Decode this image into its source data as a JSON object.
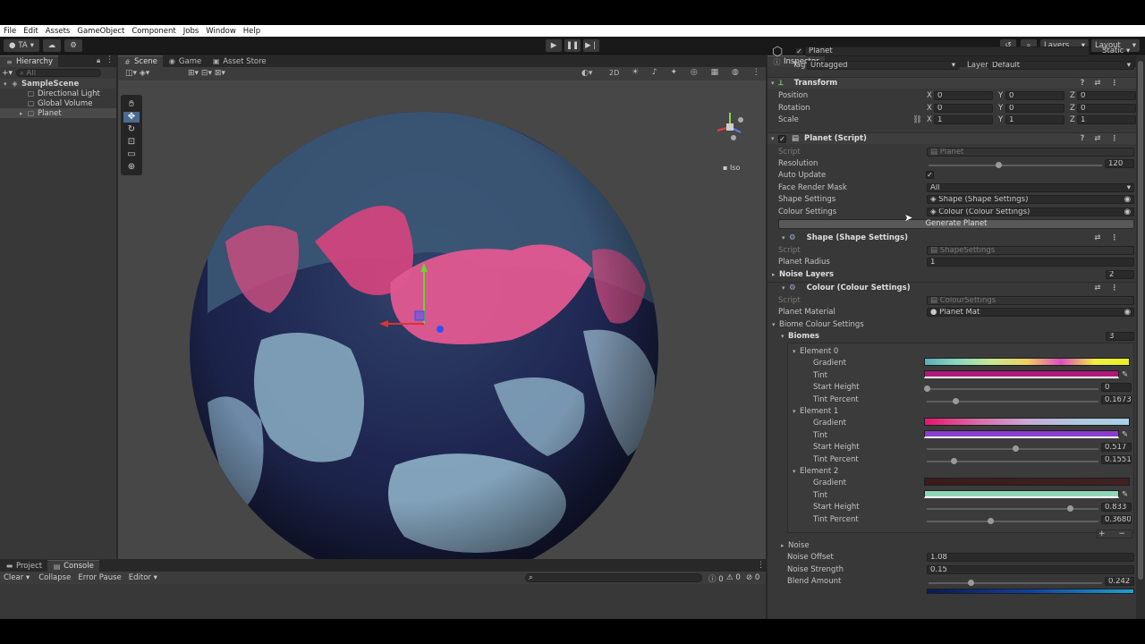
{
  "menu": [
    "File",
    "Edit",
    "Assets",
    "GameObject",
    "Component",
    "Jobs",
    "Window",
    "Help"
  ],
  "toolbar": {
    "account": "TA",
    "layers": "Layers",
    "layout": "Layout"
  },
  "hierarchy": {
    "tab": "Hierarchy",
    "search_placeholder": "All",
    "scene": "SampleScene",
    "items": [
      "Directional Light",
      "Global Volume",
      "Planet"
    ]
  },
  "scene_view": {
    "tabs": [
      "Scene",
      "Game",
      "Asset Store"
    ],
    "mode_2d": "2D",
    "iso": "Iso"
  },
  "inspector": {
    "tab": "Inspector",
    "object_name": "Planet",
    "static": "Static",
    "tag_label": "Tag",
    "tag_value": "Untagged",
    "layer_label": "Layer",
    "layer_value": "Default",
    "transform": {
      "title": "Transform",
      "rows": [
        {
          "label": "Position",
          "x": "0",
          "y": "0",
          "z": "0"
        },
        {
          "label": "Rotation",
          "x": "0",
          "y": "0",
          "z": "0"
        },
        {
          "label": "Scale",
          "x": "1",
          "y": "1",
          "z": "1"
        }
      ]
    },
    "planet_script": {
      "title": "Planet (Script)",
      "script_label": "Script",
      "script_value": "Planet",
      "resolution_label": "Resolution",
      "resolution_value": "120",
      "resolution_fraction": 0.4,
      "auto_update_label": "Auto Update",
      "face_mask_label": "Face Render Mask",
      "face_mask_value": "All",
      "shape_label": "Shape Settings",
      "shape_value": "Shape (Shape Settings)",
      "colour_label": "Colour Settings",
      "colour_value": "Colour (Colour Settings)",
      "generate_button": "Generate Planet"
    },
    "shape": {
      "title": "Shape (Shape Settings)",
      "script_label": "Script",
      "script_value": "ShapeSettings",
      "radius_label": "Planet Radius",
      "radius_value": "1",
      "noise_layers_label": "Noise Layers",
      "noise_layers_value": "2"
    },
    "colour": {
      "title": "Colour (Colour Settings)",
      "script_label": "Script",
      "script_value": "ColourSettings",
      "material_label": "Planet Material",
      "material_value": "Planet Mat",
      "biome_label": "Biome Colour Settings",
      "biomes_label": "Biomes",
      "biomes_value": "3",
      "elements": [
        {
          "name": "Element 0",
          "gradient_label": "Gradient",
          "tint_label": "Tint",
          "start_label": "Start Height",
          "start_value": "0",
          "start_fraction": 0.0,
          "tint_pct_label": "Tint Percent",
          "tint_pct_value": "0.16731",
          "tint_pct_fraction": 0.167,
          "gradient": "linear-gradient(90deg,#5ab0b8,#8ed9c0,#c9e88f,#f0d060,#e04fc0,#f0f040,#e8f020)",
          "tint": "#b0177a"
        },
        {
          "name": "Element 1",
          "gradient_label": "Gradient",
          "tint_label": "Tint",
          "start_label": "Start Height",
          "start_value": "0.517",
          "start_fraction": 0.517,
          "tint_pct_label": "Tint Percent",
          "tint_pct_value": "0.15514",
          "tint_pct_fraction": 0.155,
          "gradient": "linear-gradient(90deg,#e8146e,#d96aa6,#c8a8d8,#aec8e0,#a8d0e8)",
          "tint": "#8c3ccf"
        },
        {
          "name": "Element 2",
          "gradient_label": "Gradient",
          "tint_label": "Tint",
          "start_label": "Start Height",
          "start_value": "0.833",
          "start_fraction": 0.833,
          "tint_pct_label": "Tint Percent",
          "tint_pct_value": "0.36800",
          "tint_pct_fraction": 0.368,
          "gradient": "linear-gradient(90deg,#3a1c1c,#3e2222)",
          "tint": "#8fd6b8"
        }
      ],
      "noise_label": "Noise",
      "noise_offset_label": "Noise Offset",
      "noise_offset_value": "1.08",
      "noise_strength_label": "Noise Strength",
      "noise_strength_value": "0.15",
      "blend_label": "Blend Amount",
      "blend_value": "0.242",
      "blend_fraction": 0.242
    }
  },
  "bottom": {
    "tabs": [
      "Project",
      "Console"
    ],
    "clear": "Clear",
    "collapse": "Collapse",
    "error_pause": "Error Pause",
    "editor": "Editor",
    "counts": [
      "0",
      "0",
      "0"
    ]
  }
}
